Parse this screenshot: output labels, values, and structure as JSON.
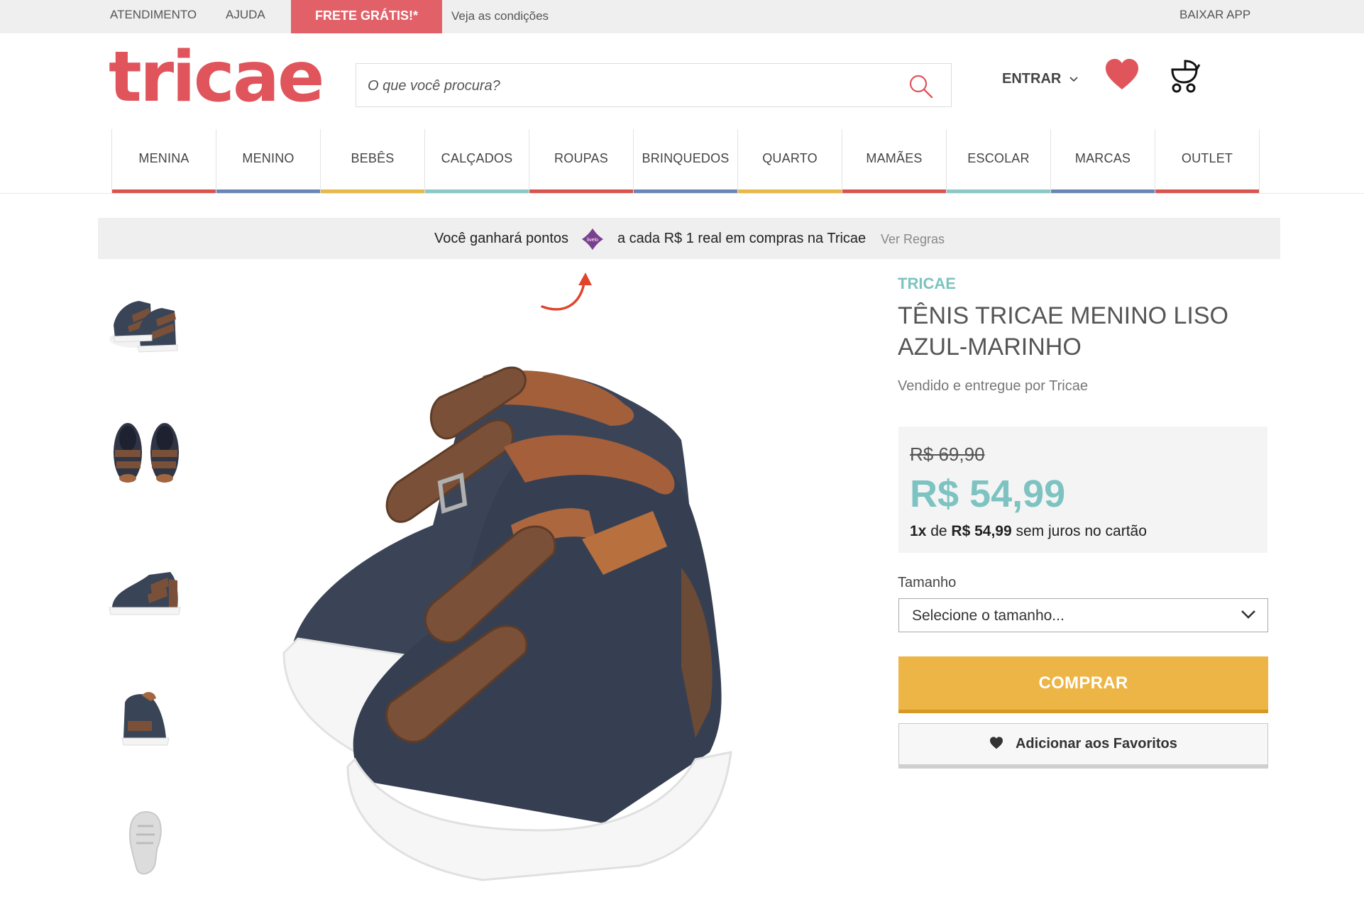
{
  "topbar": {
    "atendimento": "ATENDIMENTO",
    "ajuda": "AJUDA",
    "frete": "FRETE GRÁTIS!*",
    "veja": "Veja as condições",
    "baixar_app": "BAIXAR APP"
  },
  "header": {
    "logo": "tricae",
    "search_placeholder": "O que você procura?",
    "entrar": "ENTRAR",
    "icons": [
      "search-icon",
      "heart-icon",
      "stroller-cart-icon"
    ]
  },
  "nav": {
    "items": [
      {
        "label": "MENINA",
        "color": "#d9534f"
      },
      {
        "label": "MENINO",
        "color": "#6a86b8"
      },
      {
        "label": "BEBÊS",
        "color": "#e7b84a"
      },
      {
        "label": "CALÇADOS",
        "color": "#8ac9c7"
      },
      {
        "label": "ROUPAS",
        "color": "#d9534f"
      },
      {
        "label": "BRINQUEDOS",
        "color": "#6a86b8"
      },
      {
        "label": "QUARTO",
        "color": "#e7b84a"
      },
      {
        "label": "MAMÃES",
        "color": "#d9534f"
      },
      {
        "label": "ESCOLAR",
        "color": "#8ac9c7"
      },
      {
        "label": "MARCAS",
        "color": "#6a86b8"
      },
      {
        "label": "OUTLET",
        "color": "#d9534f"
      }
    ]
  },
  "points_banner": {
    "text_before": "Você ganhará pontos",
    "livelo_logo": "livelo",
    "text_after": "a cada R$ 1 real em compras na Tricae",
    "link": "Ver Regras"
  },
  "product": {
    "brand": "TRICAE",
    "title": "TÊNIS TRICAE MENINO LISO AZUL-MARINHO",
    "seller": "Vendido e entregue por Tricae",
    "old_price": "R$ 69,90",
    "price": "R$ 54,99",
    "install_count": "1x",
    "install_de": "de",
    "install_value": "R$ 54,99",
    "install_rest": "sem juros no cartão",
    "size_label": "Tamanho",
    "size_selected": "Selecione o tamanho...",
    "buy_label": "COMPRAR",
    "fav_label": "Adicionar aos Favoritos"
  },
  "colors": {
    "brand_red": "#e0545b",
    "teal": "#7cc3c1",
    "buy_yellow": "#ecb545"
  }
}
